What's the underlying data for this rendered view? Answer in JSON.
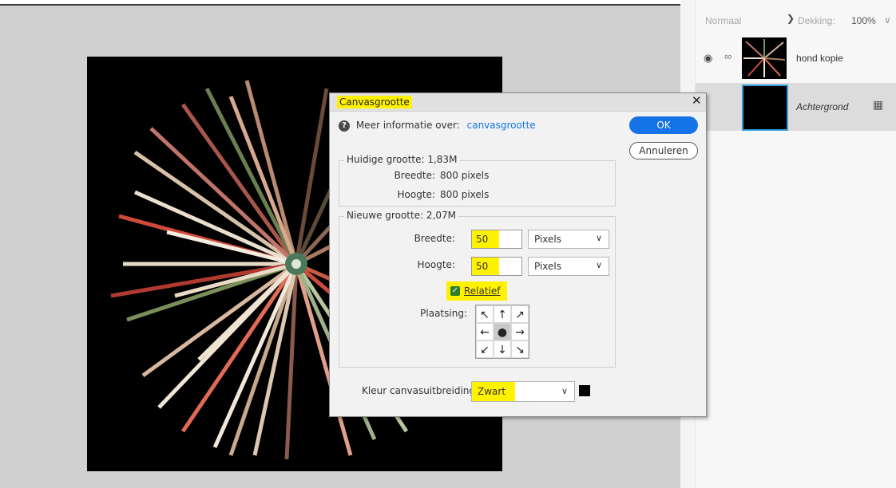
{
  "layers_panel": {
    "blend_mode": "Normaal",
    "opacity_label": "Dekking:",
    "opacity_value": "100%",
    "layers": [
      {
        "name": "hond kopie"
      },
      {
        "name": "Achtergrond"
      }
    ]
  },
  "dialog": {
    "title": "Canvasgrootte",
    "help_text": "Meer informatie over:",
    "help_link": "canvasgrootte",
    "ok_label": "OK",
    "cancel_label": "Annuleren",
    "current": {
      "label": "Huidige grootte: 1,83M",
      "width_label": "Breedte:",
      "width_value": "800 pixels",
      "height_label": "Hoogte:",
      "height_value": "800 pixels"
    },
    "new_size": {
      "label": "Nieuwe grootte: 2,07M",
      "width_label": "Breedte:",
      "width_value": "50",
      "width_unit": "Pixels",
      "height_label": "Hoogte:",
      "height_value": "50",
      "height_unit": "Pixels",
      "relative_label": "Relatief",
      "relative_checked": true,
      "anchor_label": "Plaatsing:",
      "anchor_selected": "center"
    },
    "extension_color": {
      "label": "Kleur canvasuitbreiding:",
      "value": "Zwart",
      "swatch_color": "#000000"
    }
  },
  "colors": {
    "highlight": "#fff200",
    "accent": "#1473e6"
  }
}
